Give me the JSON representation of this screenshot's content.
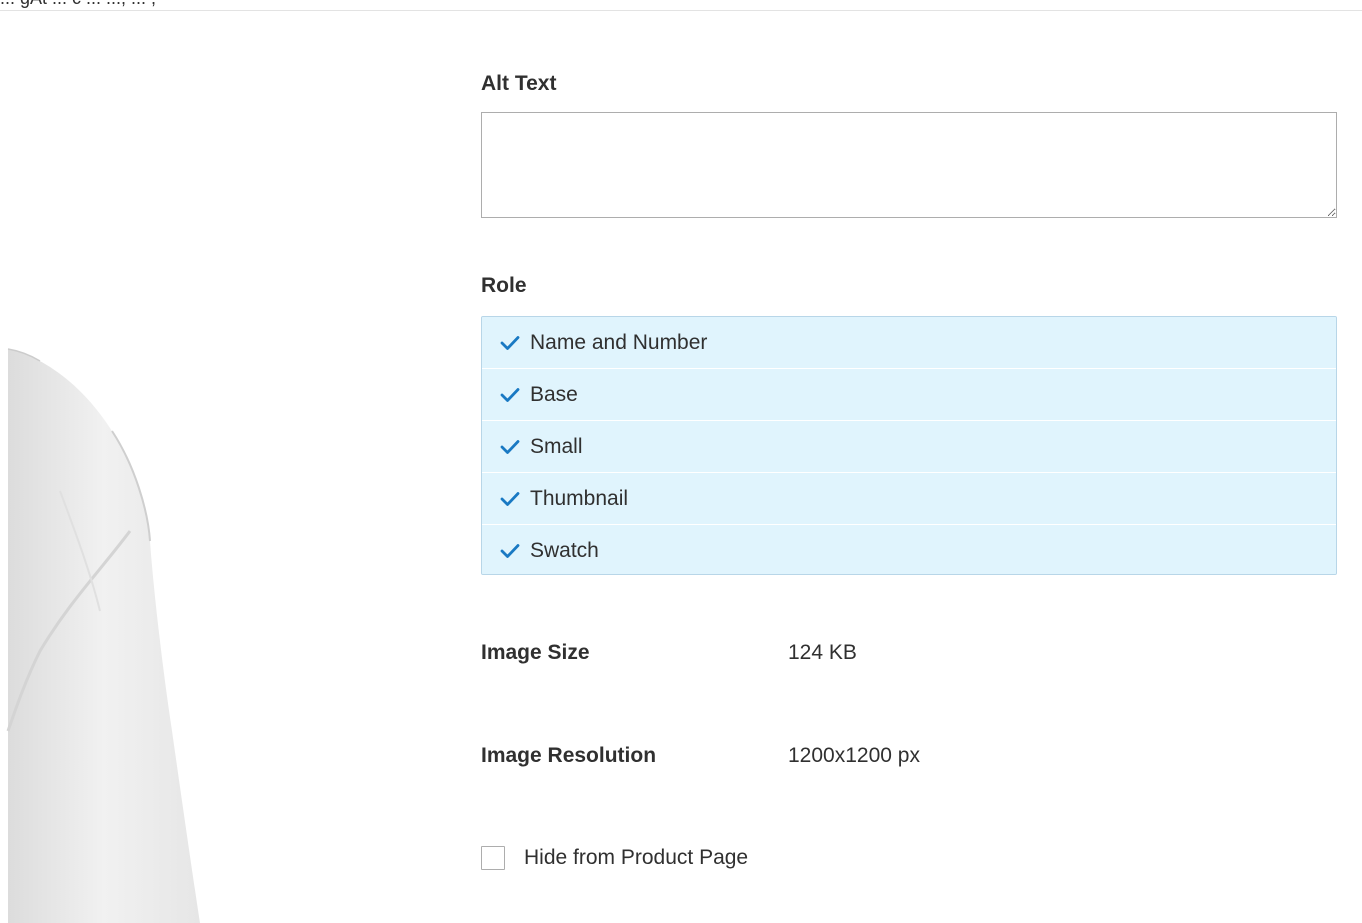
{
  "header": {
    "partial_text": "... gAt ... c ... ..., ... ,"
  },
  "alt_text": {
    "label": "Alt Text",
    "value": ""
  },
  "role": {
    "label": "Role",
    "items": [
      {
        "label": "Name and Number",
        "checked": true
      },
      {
        "label": "Base",
        "checked": true
      },
      {
        "label": "Small",
        "checked": true
      },
      {
        "label": "Thumbnail",
        "checked": true
      },
      {
        "label": "Swatch",
        "checked": true
      }
    ],
    "selected_bg": "#e0f4fd",
    "check_color": "#1979c3"
  },
  "image_info": {
    "size_label": "Image Size",
    "size_value": "124 KB",
    "resolution_label": "Image Resolution",
    "resolution_value": "1200x1200 px"
  },
  "hide_from_product_page": {
    "label": "Hide from Product Page",
    "checked": false
  },
  "preview": {
    "description_icon": "product-image-white-shirt"
  }
}
